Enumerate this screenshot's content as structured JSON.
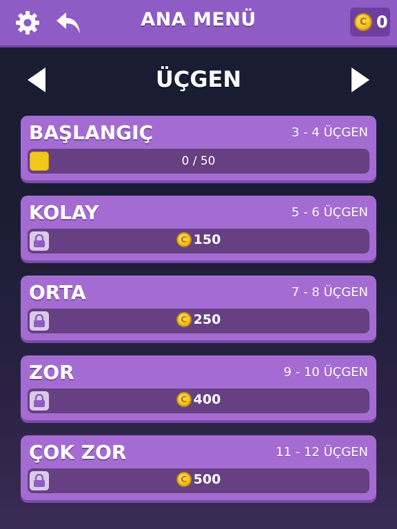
{
  "header": {
    "title": "ANA MENÜ",
    "settings_icon": "gear-icon",
    "back_icon": "back-arrow-icon",
    "coins": "0"
  },
  "shape_nav": {
    "title": "ÜÇGEN",
    "prev_icon": "triangle-left-icon",
    "next_icon": "triangle-right-icon"
  },
  "levels": [
    {
      "name": "BAŞLANGIÇ",
      "range": "3 - 4 ÜÇGEN",
      "locked": false,
      "progress_text": "0 / 50",
      "progress": 0
    },
    {
      "name": "KOLAY",
      "range": "5 - 6 ÜÇGEN",
      "locked": true,
      "cost": "150"
    },
    {
      "name": "ORTA",
      "range": "7 - 8 ÜÇGEN",
      "locked": true,
      "cost": "250"
    },
    {
      "name": "ZOR",
      "range": "9 - 10 ÜÇGEN",
      "locked": true,
      "cost": "400"
    },
    {
      "name": "ÇOK ZOR",
      "range": "11 - 12 ÜÇGEN",
      "locked": true,
      "cost": "500"
    }
  ],
  "colors": {
    "header": "#8e5cc4",
    "card": "#a46cd3",
    "bar": "#664083",
    "accent_yellow": "#f2c81e"
  }
}
